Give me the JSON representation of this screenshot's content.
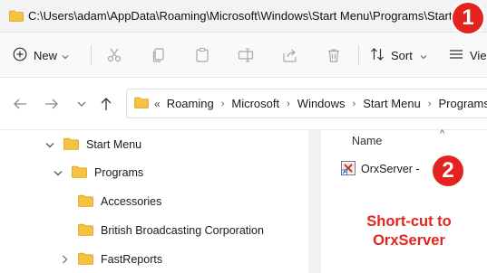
{
  "window": {
    "path": "C:\\Users\\adam\\AppData\\Roaming\\Microsoft\\Windows\\Start Menu\\Programs\\Startup"
  },
  "toolbar": {
    "new_label": "New",
    "sort_label": "Sort",
    "view_label": "Vie"
  },
  "address_bar": {
    "overflow_marker": "«",
    "crumbs": [
      "Roaming",
      "Microsoft",
      "Windows",
      "Start Menu",
      "Programs"
    ]
  },
  "tree": {
    "items": [
      {
        "label": "Start Menu"
      },
      {
        "label": "Programs"
      },
      {
        "label": "Accessories"
      },
      {
        "label": "British Broadcasting Corporation"
      },
      {
        "label": "FastReports"
      }
    ]
  },
  "file_list": {
    "column_name": "Name",
    "sort_indicator": "^",
    "files": [
      {
        "name": "OrxServer -"
      }
    ]
  },
  "annotations": {
    "badge_1": "1",
    "badge_2": "2",
    "note_line1": "Short-cut to",
    "note_line2": "OrxServer",
    "color": "#e4241f"
  },
  "colors": {
    "folder": "#f5c242",
    "accent": "#0067c0"
  }
}
